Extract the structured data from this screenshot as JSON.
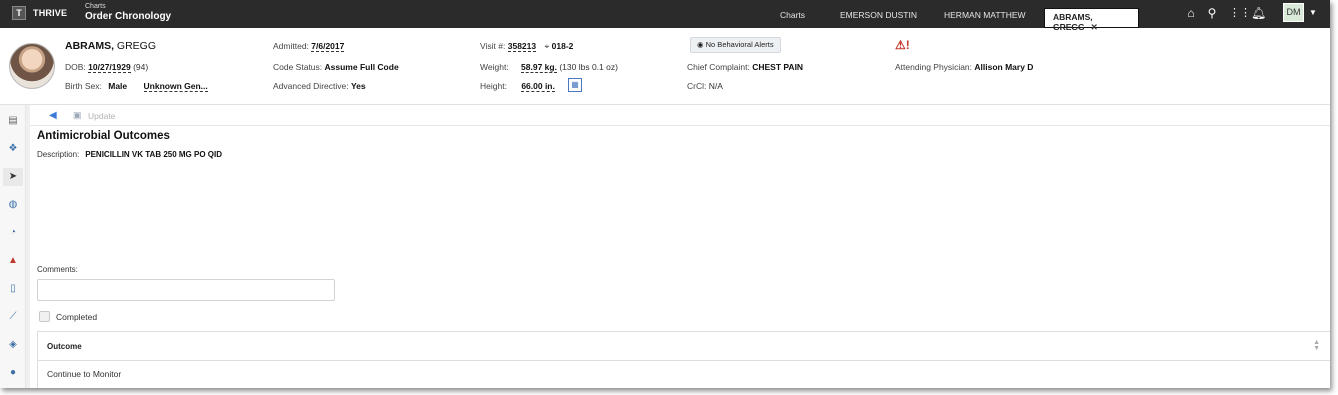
{
  "topbar": {
    "logo": "T",
    "app_name": "THRIVE",
    "breadcrumb_parent": "Charts",
    "page_title": "Order Chronology",
    "tabs": [
      {
        "label": "Charts"
      },
      {
        "label": "EMERSON DUSTIN"
      },
      {
        "label": "HERMAN MATTHEW"
      },
      {
        "label": "ABRAMS, GREGG"
      }
    ],
    "close_glyph": "✕",
    "user_initials": "DM"
  },
  "patient": {
    "last_name": "ABRAMS,",
    "first_name": "GREGG",
    "dob_label": "DOB:",
    "dob": "10/27/1929",
    "age": "(94)",
    "birth_sex_label": "Birth Sex:",
    "birth_sex": "Male",
    "gender": "Unknown Gen...",
    "admitted_label": "Admitted:",
    "admitted": "7/6/2017",
    "code_status_label": "Code Status:",
    "code_status": "Assume Full Code",
    "adv_directive_label": "Advanced Directive:",
    "adv_directive": "Yes",
    "visit_label": "Visit #:",
    "visit": "358213",
    "room": "018-2",
    "weight_label": "Weight:",
    "weight": "58.97 kg.",
    "weight_alt": "(130 lbs 0.1 oz)",
    "height_label": "Height:",
    "height": "66.00 in.",
    "alerts_button": "No Behavioral Alerts",
    "chief_complaint_label": "Chief Complaint:",
    "chief_complaint": "CHEST PAIN",
    "crcl_label": "CrCl:",
    "crcl": "N/A",
    "attending_label": "Attending Physician:",
    "attending": "Allison Mary D"
  },
  "toolbar": {
    "update_label": "Update"
  },
  "main": {
    "title": "Antimicrobial Outcomes",
    "description_label": "Description:",
    "description": "PENICILLIN VK TAB 250 MG PO QID",
    "comments_label": "Comments:",
    "completed_label": "Completed",
    "grid": {
      "column_header": "Outcome",
      "rows": [
        "Continue to Monitor"
      ]
    }
  },
  "icons": {
    "colors": {
      "topbar": "#2b2b2b",
      "link": "#3b7bd6",
      "alert": "#c0392b"
    }
  }
}
